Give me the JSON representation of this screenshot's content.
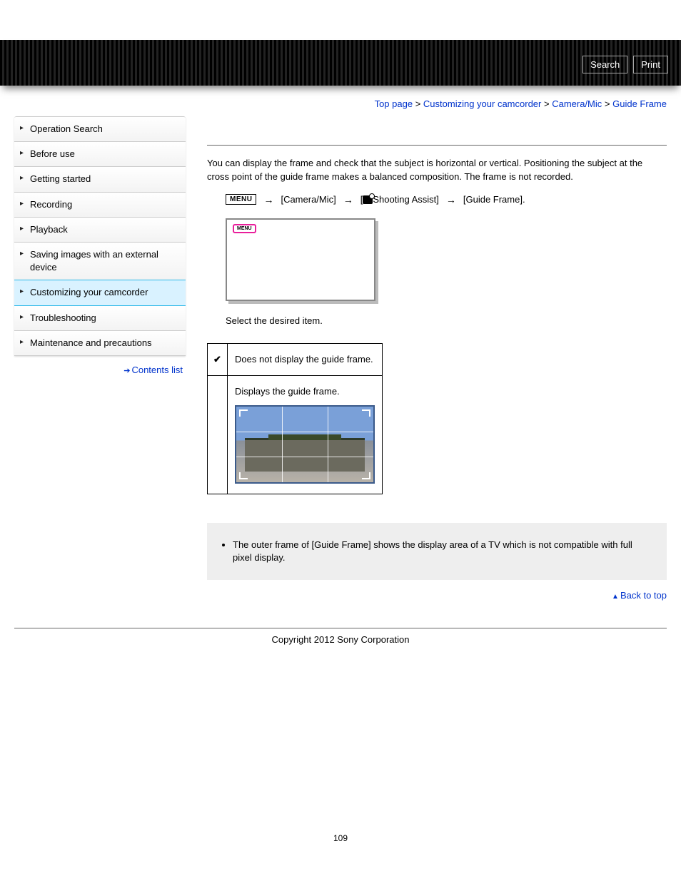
{
  "header": {
    "search": "Search",
    "print": "Print"
  },
  "breadcrumb": {
    "items": [
      "Top page",
      "Customizing your camcorder",
      "Camera/Mic"
    ],
    "current": "Guide Frame",
    "sep": ">"
  },
  "sidebar": {
    "items": [
      "Operation Search",
      "Before use",
      "Getting started",
      "Recording",
      "Playback",
      "Saving images with an external device",
      "Customizing your camcorder",
      "Troubleshooting",
      "Maintenance and precautions"
    ],
    "active_index": 6,
    "contents_list": "Contents list"
  },
  "main": {
    "intro": "You can display the frame and check that the subject is horizontal or vertical. Positioning the subject at the cross point of the guide frame makes a balanced composition. The frame is not recorded.",
    "menu_label": "MENU",
    "path": {
      "p1": "[Camera/Mic]",
      "p2a": "[",
      "p2b": "Shooting Assist]",
      "p3": "[Guide Frame]."
    },
    "preview_menu": "MENU",
    "select_text": "Select the desired item.",
    "table": {
      "off": "Does not display the guide frame.",
      "on": "Displays the guide frame."
    },
    "note": "The outer frame of [Guide Frame] shows the display area of a TV which is not compatible with full pixel display.",
    "back_to_top": "Back to top",
    "copyright": "Copyright 2012 Sony Corporation",
    "page_number": "109"
  }
}
